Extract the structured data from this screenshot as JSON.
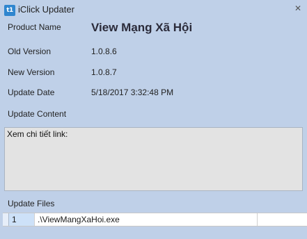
{
  "window": {
    "title": "iClick Updater",
    "icon_text": "t1",
    "close_symbol": "✕"
  },
  "fields": {
    "product_name_label": "Product Name",
    "product_name_value": "View Mạng Xã Hội",
    "old_version_label": "Old Version",
    "old_version_value": "1.0.8.6",
    "new_version_label": "New Version",
    "new_version_value": "1.0.8.7",
    "update_date_label": "Update Date",
    "update_date_value": "5/18/2017 3:32:48 PM",
    "update_content_label": "Update Content",
    "update_content_value": "Xem chi tiết link:",
    "update_files_label": "Update Files"
  },
  "files": [
    {
      "index": "1",
      "path": ".\\ViewMangXaHoi.exe"
    }
  ],
  "icons": {
    "app": "iclick-app-icon",
    "close": "close-icon"
  },
  "colors": {
    "window_bg": "#bfd0e8",
    "content_bg": "#e3e3e3",
    "icon_bg": "#2f86cf",
    "selected_cell": "#cde1f8"
  }
}
